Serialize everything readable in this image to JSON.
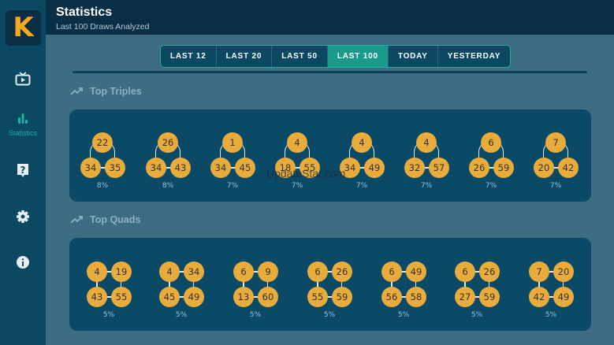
{
  "header": {
    "title": "Statistics",
    "subtitle": "Last 100 Draws Analyzed"
  },
  "sidebar": {
    "logo": "K",
    "items": [
      {
        "icon": "tv-icon",
        "label": ""
      },
      {
        "icon": "bar-chart-icon",
        "label": "Statistics",
        "active": true
      },
      {
        "icon": "help-icon",
        "label": ""
      },
      {
        "icon": "gear-icon",
        "label": ""
      },
      {
        "icon": "info-icon",
        "label": ""
      }
    ]
  },
  "tabs": [
    {
      "label": "LAST 12"
    },
    {
      "label": "LAST 20"
    },
    {
      "label": "LAST 50"
    },
    {
      "label": "LAST 100",
      "active": true
    },
    {
      "label": "TODAY"
    },
    {
      "label": "YESTERDAY"
    }
  ],
  "triples": {
    "title": "Top Triples",
    "items": [
      {
        "n": [
          "22",
          "34",
          "35"
        ],
        "pct": "8%"
      },
      {
        "n": [
          "26",
          "34",
          "43"
        ],
        "pct": "8%"
      },
      {
        "n": [
          "1",
          "34",
          "45"
        ],
        "pct": "7%"
      },
      {
        "n": [
          "4",
          "18",
          "55"
        ],
        "pct": "7%"
      },
      {
        "n": [
          "4",
          "34",
          "49"
        ],
        "pct": "7%"
      },
      {
        "n": [
          "4",
          "32",
          "57"
        ],
        "pct": "7%"
      },
      {
        "n": [
          "6",
          "26",
          "59"
        ],
        "pct": "7%"
      },
      {
        "n": [
          "7",
          "20",
          "42"
        ],
        "pct": "7%"
      }
    ]
  },
  "quads": {
    "title": "Top Quads",
    "items": [
      {
        "n": [
          "4",
          "19",
          "43",
          "55"
        ],
        "pct": "5%"
      },
      {
        "n": [
          "4",
          "34",
          "45",
          "49"
        ],
        "pct": "5%"
      },
      {
        "n": [
          "6",
          "9",
          "13",
          "60"
        ],
        "pct": "5%"
      },
      {
        "n": [
          "6",
          "26",
          "55",
          "59"
        ],
        "pct": "5%"
      },
      {
        "n": [
          "6",
          "49",
          "56",
          "58"
        ],
        "pct": "5%"
      },
      {
        "n": [
          "6",
          "26",
          "27",
          "59"
        ],
        "pct": "5%"
      },
      {
        "n": [
          "7",
          "20",
          "42",
          "49"
        ],
        "pct": "5%"
      }
    ]
  },
  "watermark": "UpdateStar.com",
  "colors": {
    "accent": "#1a9a8a",
    "ball": "#e8ac3c",
    "logo": "#f5a623"
  }
}
